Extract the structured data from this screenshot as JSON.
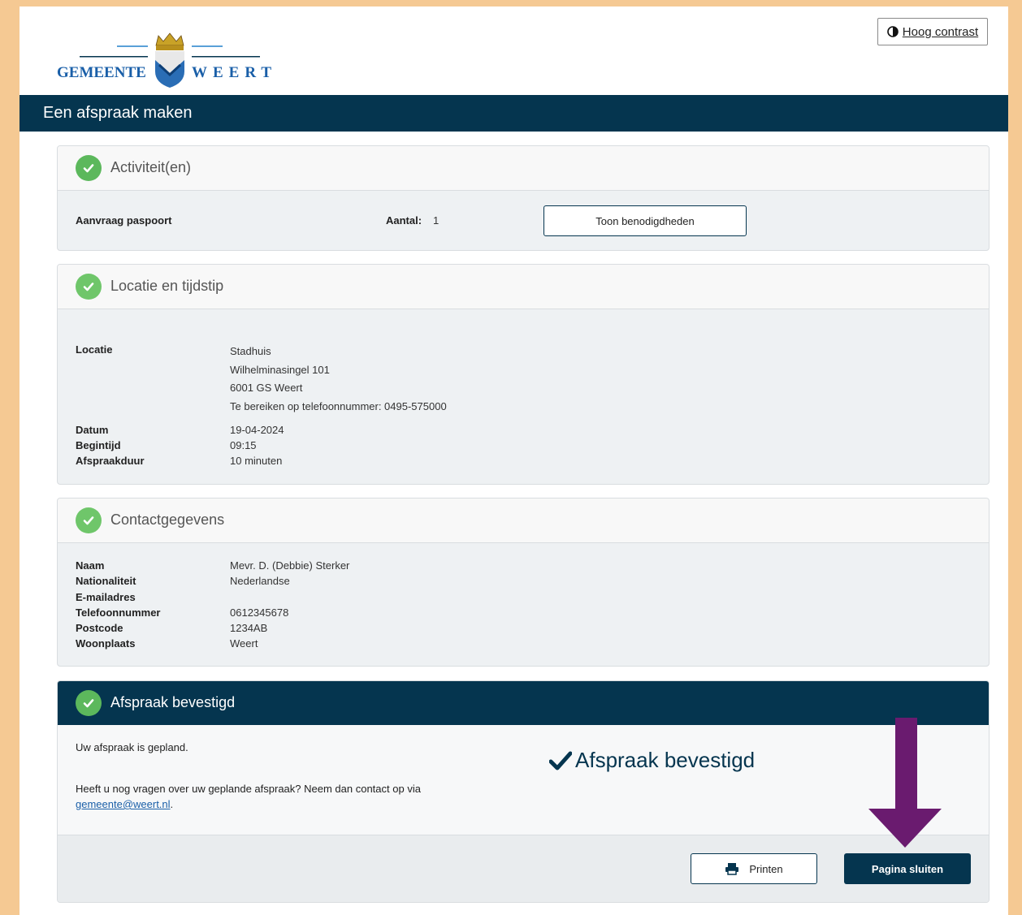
{
  "header": {
    "logo": {
      "left_text": "GEMEENTE",
      "right_text": "WEERT"
    },
    "contrast_button": {
      "icon": "half-circle-contrast-icon",
      "label": "Hoog contrast"
    }
  },
  "title_bar": {
    "title": "Een afspraak maken"
  },
  "sections": {
    "activities": {
      "title": "Activiteit(en)",
      "activity_name": "Aanvraag paspoort",
      "count_label": "Aantal:",
      "count_value": "1",
      "show_requirements_button": "Toon benodigdheden"
    },
    "location": {
      "title": "Locatie en tijdstip",
      "location_label": "Locatie",
      "location_lines": [
        "Stadhuis",
        "Wilhelminasingel 101",
        "6001 GS Weert",
        "Te bereiken op telefoonnummer: 0495-575000"
      ],
      "date_label": "Datum",
      "date_value": "19-04-2024",
      "start_label": "Begintijd",
      "start_value": "09:15",
      "duration_label": "Afspraakduur",
      "duration_value": "10 minuten"
    },
    "contact": {
      "title": "Contactgegevens",
      "rows": [
        {
          "label": "Naam",
          "value": "Mevr. D. (Debbie) Sterker"
        },
        {
          "label": "Nationaliteit",
          "value": "Nederlandse"
        },
        {
          "label": "E-mailadres",
          "value": ""
        },
        {
          "label": "Telefoonnummer",
          "value": "0612345678"
        },
        {
          "label": "Postcode",
          "value": "1234AB"
        },
        {
          "label": "Woonplaats",
          "value": "Weert"
        }
      ]
    },
    "confirmation": {
      "title": "Afspraak bevestigd",
      "message": "Uw afspraak is gepland.",
      "question": "Heeft u nog vragen over uw geplande afspraak? Neem dan contact op via",
      "email": "gemeente@weert.nl",
      "email_suffix": ".",
      "big_status": "Afspraak bevestigd",
      "print_button": "Printen",
      "close_button": "Pagina sluiten"
    }
  },
  "colors": {
    "navy": "#05354f",
    "success_green": "#5cb85c",
    "annotation_purple": "#6a1b6f",
    "page_border": "#f5c993"
  }
}
